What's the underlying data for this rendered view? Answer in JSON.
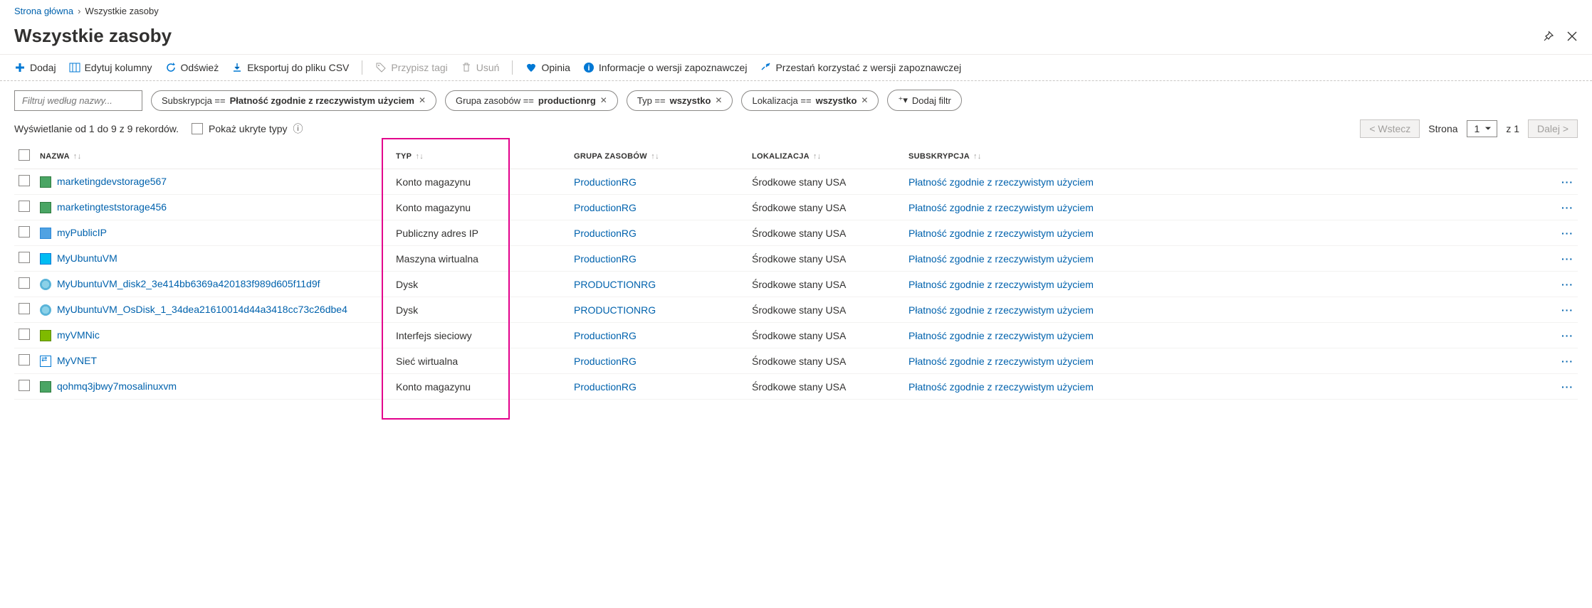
{
  "breadcrumb": {
    "home": "Strona główna",
    "current": "Wszystkie zasoby"
  },
  "page": {
    "title": "Wszystkie zasoby"
  },
  "toolbar": {
    "add": "Dodaj",
    "edit_columns": "Edytuj kolumny",
    "refresh": "Odśwież",
    "export_csv": "Eksportuj do pliku CSV",
    "assign_tags": "Przypisz tagi",
    "delete": "Usuń",
    "feedback": "Opinia",
    "preview_info": "Informacje o wersji zapoznawczej",
    "leave_preview": "Przestań korzystać z wersji zapoznawczej"
  },
  "filters": {
    "name_placeholder": "Filtruj według nazwy...",
    "sub_key": "Subskrypcja == ",
    "sub_val": "Płatność zgodnie z rzeczywistym użyciem",
    "rg_key": "Grupa zasobów == ",
    "rg_val": "productionrg",
    "type_key": "Typ == ",
    "type_val": "wszystko",
    "loc_key": "Lokalizacja == ",
    "loc_val": "wszystko",
    "add_filter": "Dodaj filtr"
  },
  "meta": {
    "showing": "Wyświetlanie od 1 do 9 z 9 rekordów.",
    "show_hidden": "Pokaż ukryte typy",
    "back": "< Wstecz",
    "page_label": "Strona",
    "page_num": "1",
    "of": "z 1",
    "next": "Dalej >"
  },
  "columns": {
    "name": "NAZWA",
    "type": "TYP",
    "rg": "GRUPA ZASOBÓW",
    "loc": "LOKALIZACJA",
    "sub": "SUBSKRYPCJA"
  },
  "rows": [
    {
      "name": "marketingdevstorage567",
      "type": "Konto magazynu",
      "rg": "ProductionRG",
      "loc": "Środkowe stany USA",
      "sub": "Płatność zgodnie z rzeczywistym użyciem",
      "icon": "ic-storage"
    },
    {
      "name": "marketingteststorage456",
      "type": "Konto magazynu",
      "rg": "ProductionRG",
      "loc": "Środkowe stany USA",
      "sub": "Płatność zgodnie z rzeczywistym użyciem",
      "icon": "ic-storage"
    },
    {
      "name": "myPublicIP",
      "type": "Publiczny adres IP",
      "rg": "ProductionRG",
      "loc": "Środkowe stany USA",
      "sub": "Płatność zgodnie z rzeczywistym użyciem",
      "icon": "ic-ip"
    },
    {
      "name": "MyUbuntuVM",
      "type": "Maszyna wirtualna",
      "rg": "ProductionRG",
      "loc": "Środkowe stany USA",
      "sub": "Płatność zgodnie z rzeczywistym użyciem",
      "icon": "ic-vm"
    },
    {
      "name": "MyUbuntuVM_disk2_3e414bb6369a420183f989d605f11d9f",
      "type": "Dysk",
      "rg": "PRODUCTIONRG",
      "loc": "Środkowe stany USA",
      "sub": "Płatność zgodnie z rzeczywistym użyciem",
      "icon": "ic-disk"
    },
    {
      "name": "MyUbuntuVM_OsDisk_1_34dea21610014d44a3418cc73c26dbe4",
      "type": "Dysk",
      "rg": "PRODUCTIONRG",
      "loc": "Środkowe stany USA",
      "sub": "Płatność zgodnie z rzeczywistym użyciem",
      "icon": "ic-disk"
    },
    {
      "name": "myVMNic",
      "type": "Interfejs sieciowy",
      "rg": "ProductionRG",
      "loc": "Środkowe stany USA",
      "sub": "Płatność zgodnie z rzeczywistym użyciem",
      "icon": "ic-nic"
    },
    {
      "name": "MyVNET",
      "type": "Sieć wirtualna",
      "rg": "ProductionRG",
      "loc": "Środkowe stany USA",
      "sub": "Płatność zgodnie z rzeczywistym użyciem",
      "icon": "ic-vnet"
    },
    {
      "name": "qohmq3jbwy7mosalinuxvm",
      "type": "Konto magazynu",
      "rg": "ProductionRG",
      "loc": "Środkowe stany USA",
      "sub": "Płatność zgodnie z rzeczywistym użyciem",
      "icon": "ic-storage"
    }
  ]
}
